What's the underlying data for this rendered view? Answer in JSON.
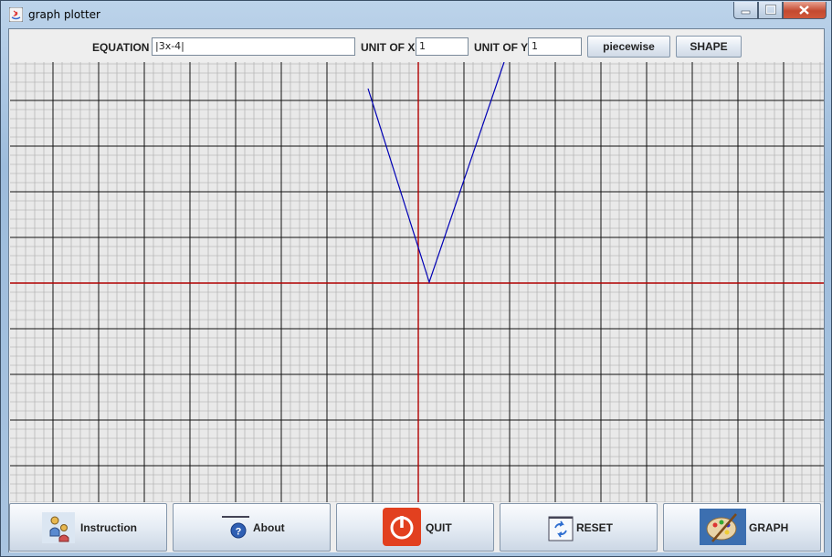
{
  "window": {
    "title": "graph plotter"
  },
  "toolbar": {
    "equation_label": "EQUATION",
    "equation_value": "|3x-4|",
    "unit_x_label": "UNIT OF X",
    "unit_x_value": "1",
    "unit_y_label": "UNIT OF Y",
    "unit_y_value": "1",
    "piecewise_label": "piecewise",
    "shape_label": "SHAPE"
  },
  "buttons": {
    "instruction": "Instruction",
    "about": "About",
    "quit": "QUIT",
    "reset": "RESET",
    "graph": "GRAPH"
  },
  "colors": {
    "axis": "#b10000",
    "curve": "#0000b4",
    "quit": "#e2401f"
  }
}
